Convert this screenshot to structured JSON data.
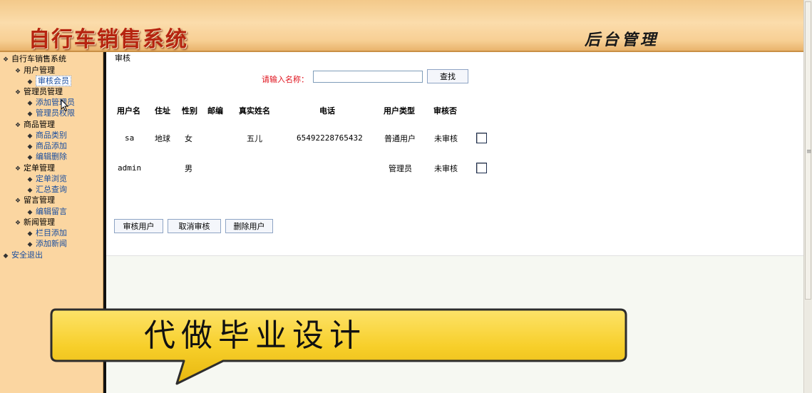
{
  "banner": {
    "title": "自行车销售系统",
    "subtitle": "后台管理"
  },
  "sidebar": {
    "root_label": "自行车销售系统",
    "groups": [
      {
        "label": "用户管理",
        "items": [
          {
            "label": "审核会员"
          }
        ]
      },
      {
        "label": "管理员管理",
        "items": [
          {
            "label": "添加管理员"
          },
          {
            "label": "管理员权限"
          }
        ]
      },
      {
        "label": "商品管理",
        "items": [
          {
            "label": "商品类别"
          },
          {
            "label": "商品添加"
          },
          {
            "label": "编辑删除"
          }
        ]
      },
      {
        "label": "定单管理",
        "items": [
          {
            "label": "定单浏览"
          },
          {
            "label": "汇总查询"
          }
        ]
      },
      {
        "label": "留言管理",
        "items": [
          {
            "label": "编辑留言"
          }
        ]
      },
      {
        "label": "新闻管理",
        "items": [
          {
            "label": "栏目添加"
          },
          {
            "label": "添加新闻"
          }
        ]
      }
    ],
    "logout_label": "安全退出"
  },
  "main": {
    "breadcrumb": "审核",
    "search": {
      "label": "请输入名称：",
      "value": "",
      "button_label": "查找"
    },
    "table": {
      "headers": [
        "用户名",
        "住址",
        "性别",
        "邮编",
        "真实姓名",
        "电话",
        "用户类型",
        "审核否"
      ],
      "rows": [
        {
          "username": "sa",
          "address": "地球",
          "gender": "女",
          "zip": "",
          "real_name": "五儿",
          "phone": "65492228765432",
          "user_type": "普通用户",
          "status": "未审核"
        },
        {
          "username": "admin",
          "address": "",
          "gender": "男",
          "zip": "",
          "real_name": "",
          "phone": "",
          "user_type": "管理员",
          "status": "未审核"
        }
      ]
    },
    "actions": {
      "approve_label": "审核用户",
      "cancel_label": "取消审核",
      "delete_label": "删除用户"
    }
  },
  "overlay": {
    "callout_text": "代做毕业设计"
  },
  "colors": {
    "banner_title": "#b62410",
    "sidebar_bg": "#fbd6a1",
    "search_label": "#e0141f",
    "callout_fill": "#f7cf2a"
  }
}
